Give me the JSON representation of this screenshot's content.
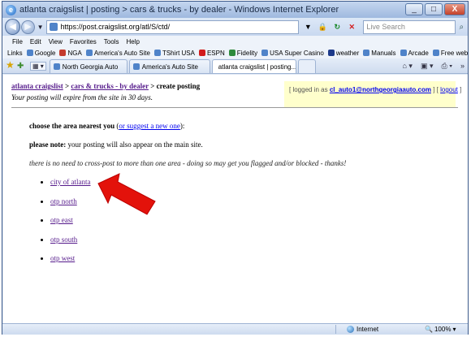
{
  "window": {
    "title": "atlanta craigslist | posting > cars & trucks - by dealer - Windows Internet Explorer",
    "minimize": "_",
    "maximize": "□",
    "close": "X"
  },
  "address_bar": {
    "url": "https://post.craigslist.org/atl/S/ctd/",
    "search_placeholder": "Live Search"
  },
  "menu": [
    "File",
    "Edit",
    "View",
    "Favorites",
    "Tools",
    "Help"
  ],
  "links_bar": {
    "label": "Links",
    "items": [
      {
        "label": "Google",
        "color": "#4f83c9"
      },
      {
        "label": "NGA",
        "color": "#c43b2e"
      },
      {
        "label": "America's Auto Site",
        "color": "#4f83c9"
      },
      {
        "label": "TShirt USA",
        "color": "#4f83c9"
      },
      {
        "label": "ESPN",
        "color": "#d21b1b"
      },
      {
        "label": "Fidelity",
        "color": "#2e8a3c"
      },
      {
        "label": "USA Super Casino",
        "color": "#4f83c9"
      },
      {
        "label": "weather",
        "color": "#1d3a8a"
      },
      {
        "label": "Manuals",
        "color": "#4f83c9"
      },
      {
        "label": "Arcade",
        "color": "#4f83c9"
      },
      {
        "label": "Free website games",
        "color": "#4f83c9"
      }
    ]
  },
  "tabs": [
    {
      "label": "North Georgia Auto",
      "active": false
    },
    {
      "label": "America's Auto Site",
      "active": false
    },
    {
      "label": "atlanta craigslist | posting...",
      "active": true
    }
  ],
  "page": {
    "breadcrumb_site": "atlanta craigslist",
    "breadcrumb_sep1": " > ",
    "breadcrumb_category": "cars & trucks - by dealer",
    "breadcrumb_tail": " > create posting",
    "expire_notice": "Your posting will expire from the site in 30 days.",
    "userbox": {
      "prefix": "[ logged in as ",
      "email": "cl_auto1@northgeorgiaauto.com",
      "mid": " ] [ ",
      "logout": "logout",
      "suffix": " ]"
    },
    "choose_label": "choose the area nearest you",
    "suggest_open": " (",
    "suggest_link": "or suggest a new one",
    "suggest_close": "):",
    "note_label": "please note:",
    "note_text": " your posting will also appear on the main site.",
    "crosspost_warning": "there is no need to cross-post to more than one area - doing so may get you flagged and/or blocked - thanks!",
    "areas": [
      "city of atlanta",
      "otp north",
      "otp east",
      "otp south",
      "otp west"
    ]
  },
  "status_bar": {
    "zone": "Internet",
    "zoom": "100%"
  },
  "colors": {
    "arrow": "#e3120b",
    "visited_link": "#551a8b",
    "link": "#0000ee",
    "userbox_bg": "#ffffcc"
  }
}
